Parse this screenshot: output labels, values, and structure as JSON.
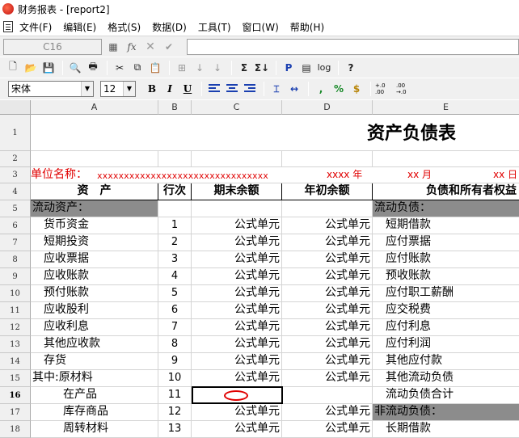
{
  "window": {
    "title": "财务报表 - [report2]"
  },
  "menu": [
    "文件(F)",
    "编辑(E)",
    "格式(S)",
    "数据(D)",
    "工具(T)",
    "窗口(W)",
    "帮助(H)"
  ],
  "formula_bar": {
    "cell_ref": "C16",
    "fx_label": "fx",
    "value": ""
  },
  "toolbar": {
    "sum_label": "Σ",
    "sum2_label": "Σ↓",
    "p_label": "P",
    "log_label": "log",
    "help_label": "?"
  },
  "format_bar": {
    "font": "宋体",
    "size": "12",
    "bold": "B",
    "italic": "I",
    "underline": "U",
    "comma": ",",
    "percent": "%",
    "currency": "$",
    "inc_decimal": "+.0 .00",
    "dec_decimal": ".00 →.0"
  },
  "columns": [
    "A",
    "B",
    "C",
    "D",
    "E"
  ],
  "rows": [
    "1",
    "2",
    "3",
    "4",
    "5",
    "6",
    "7",
    "8",
    "9",
    "10",
    "11",
    "12",
    "13",
    "14",
    "15",
    "16",
    "17",
    "18"
  ],
  "sheet": {
    "title": "资产负债表",
    "unit_label": "单位名称：",
    "unit_placeholder": "xxxxxxxxxxxxxxxxxxxxxxxxxxxxxxxx",
    "year": "xxxx 年",
    "month": "xx 月",
    "day": "xx 日",
    "headers": {
      "asset": "资　产",
      "row_no": "行次",
      "end_balance": "期末余额",
      "begin_balance": "年初余额",
      "liability": "负债和所有者权益"
    },
    "section_current_assets": "流动资产：",
    "section_current_liabilities": "流动负债：",
    "section_noncurrent_liabilities": "非流动负债：",
    "formula_text": "公式单元",
    "asset_rows": [
      {
        "name": "货币资金",
        "no": "1",
        "liab": "短期借款"
      },
      {
        "name": "短期投资",
        "no": "2",
        "liab": "应付票据"
      },
      {
        "name": "应收票据",
        "no": "3",
        "liab": "应付账款"
      },
      {
        "name": "应收账款",
        "no": "4",
        "liab": "预收账款"
      },
      {
        "name": "预付账款",
        "no": "5",
        "liab": "应付职工薪酬"
      },
      {
        "name": "应收股利",
        "no": "6",
        "liab": "应交税费"
      },
      {
        "name": "应收利息",
        "no": "7",
        "liab": "应付利息"
      },
      {
        "name": "其他应收款",
        "no": "8",
        "liab": "应付利润"
      },
      {
        "name": "存货",
        "no": "9",
        "liab": "其他应付款"
      },
      {
        "name": "其中:原材料",
        "no": "10",
        "liab": "其他流动负债"
      },
      {
        "name": "在产品",
        "no": "11",
        "liab": "流动负债合计"
      },
      {
        "name": "库存商品",
        "no": "12",
        "liab": ""
      },
      {
        "name": "周转材料",
        "no": "13",
        "liab": "长期借款"
      }
    ]
  }
}
